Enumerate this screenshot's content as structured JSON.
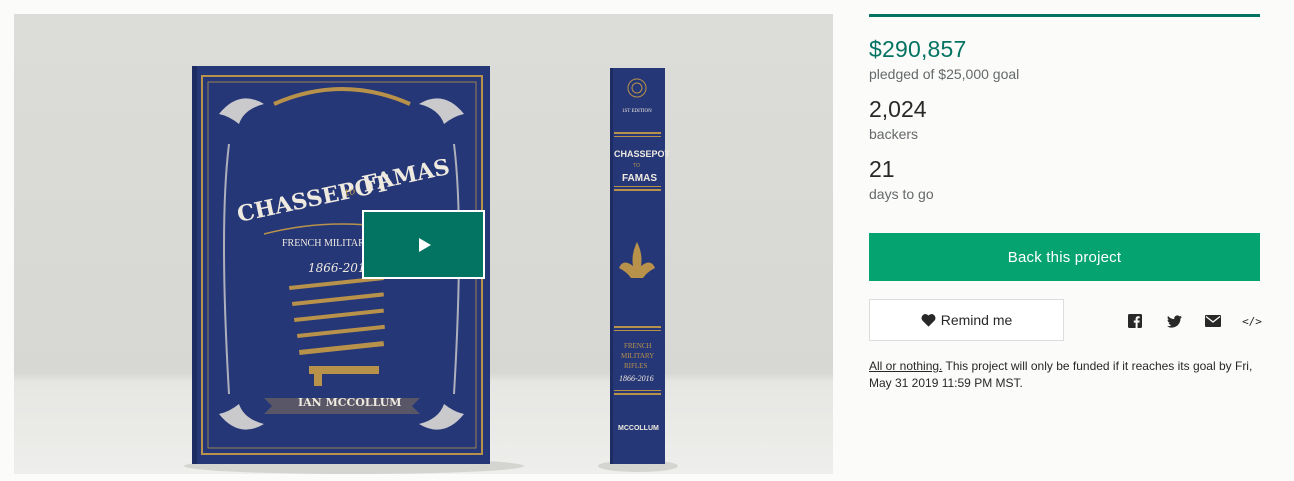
{
  "video": {
    "cover": {
      "title_line1": "CHASSEPOT",
      "title_to": "to",
      "title_line2": "FAMAS",
      "subtitle": "FRENCH MILITARY RIFLES",
      "years": "1866-2016",
      "author": "IAN MCCOLLUM"
    },
    "spine": {
      "edition": "1ST EDITION",
      "title_line1": "CHASSEPOT",
      "title_to": "TO",
      "title_line2": "FAMAS",
      "subtitle_lines": [
        "FRENCH",
        "MILITARY",
        "RIFLES",
        "1866-2016"
      ],
      "author": "MCCOLLUM"
    },
    "play_icon": "play-icon",
    "colors": {
      "book": "#263777",
      "gold": "#b8924a",
      "play": "#037362"
    }
  },
  "stats": {
    "pledged": "$290,857",
    "pledged_caption": "pledged of $25,000 goal",
    "funded_fraction": 1.0,
    "backers": "2,024",
    "backers_caption": "backers",
    "days": "21",
    "days_caption": "days to go"
  },
  "actions": {
    "back_label": "Back this project",
    "remind_label": "Remind me",
    "share_icons": [
      "facebook-icon",
      "twitter-icon",
      "email-icon",
      "embed-icon"
    ],
    "embed_glyph": "</>"
  },
  "note": {
    "all_or_nothing": "All or nothing.",
    "text": " This project will only be funded if it reaches its goal by Fri, May 31 2019 11:59 PM MST."
  },
  "colors": {
    "accent": "#037362",
    "back_button": "#04a370",
    "muted_text": "#656969"
  }
}
